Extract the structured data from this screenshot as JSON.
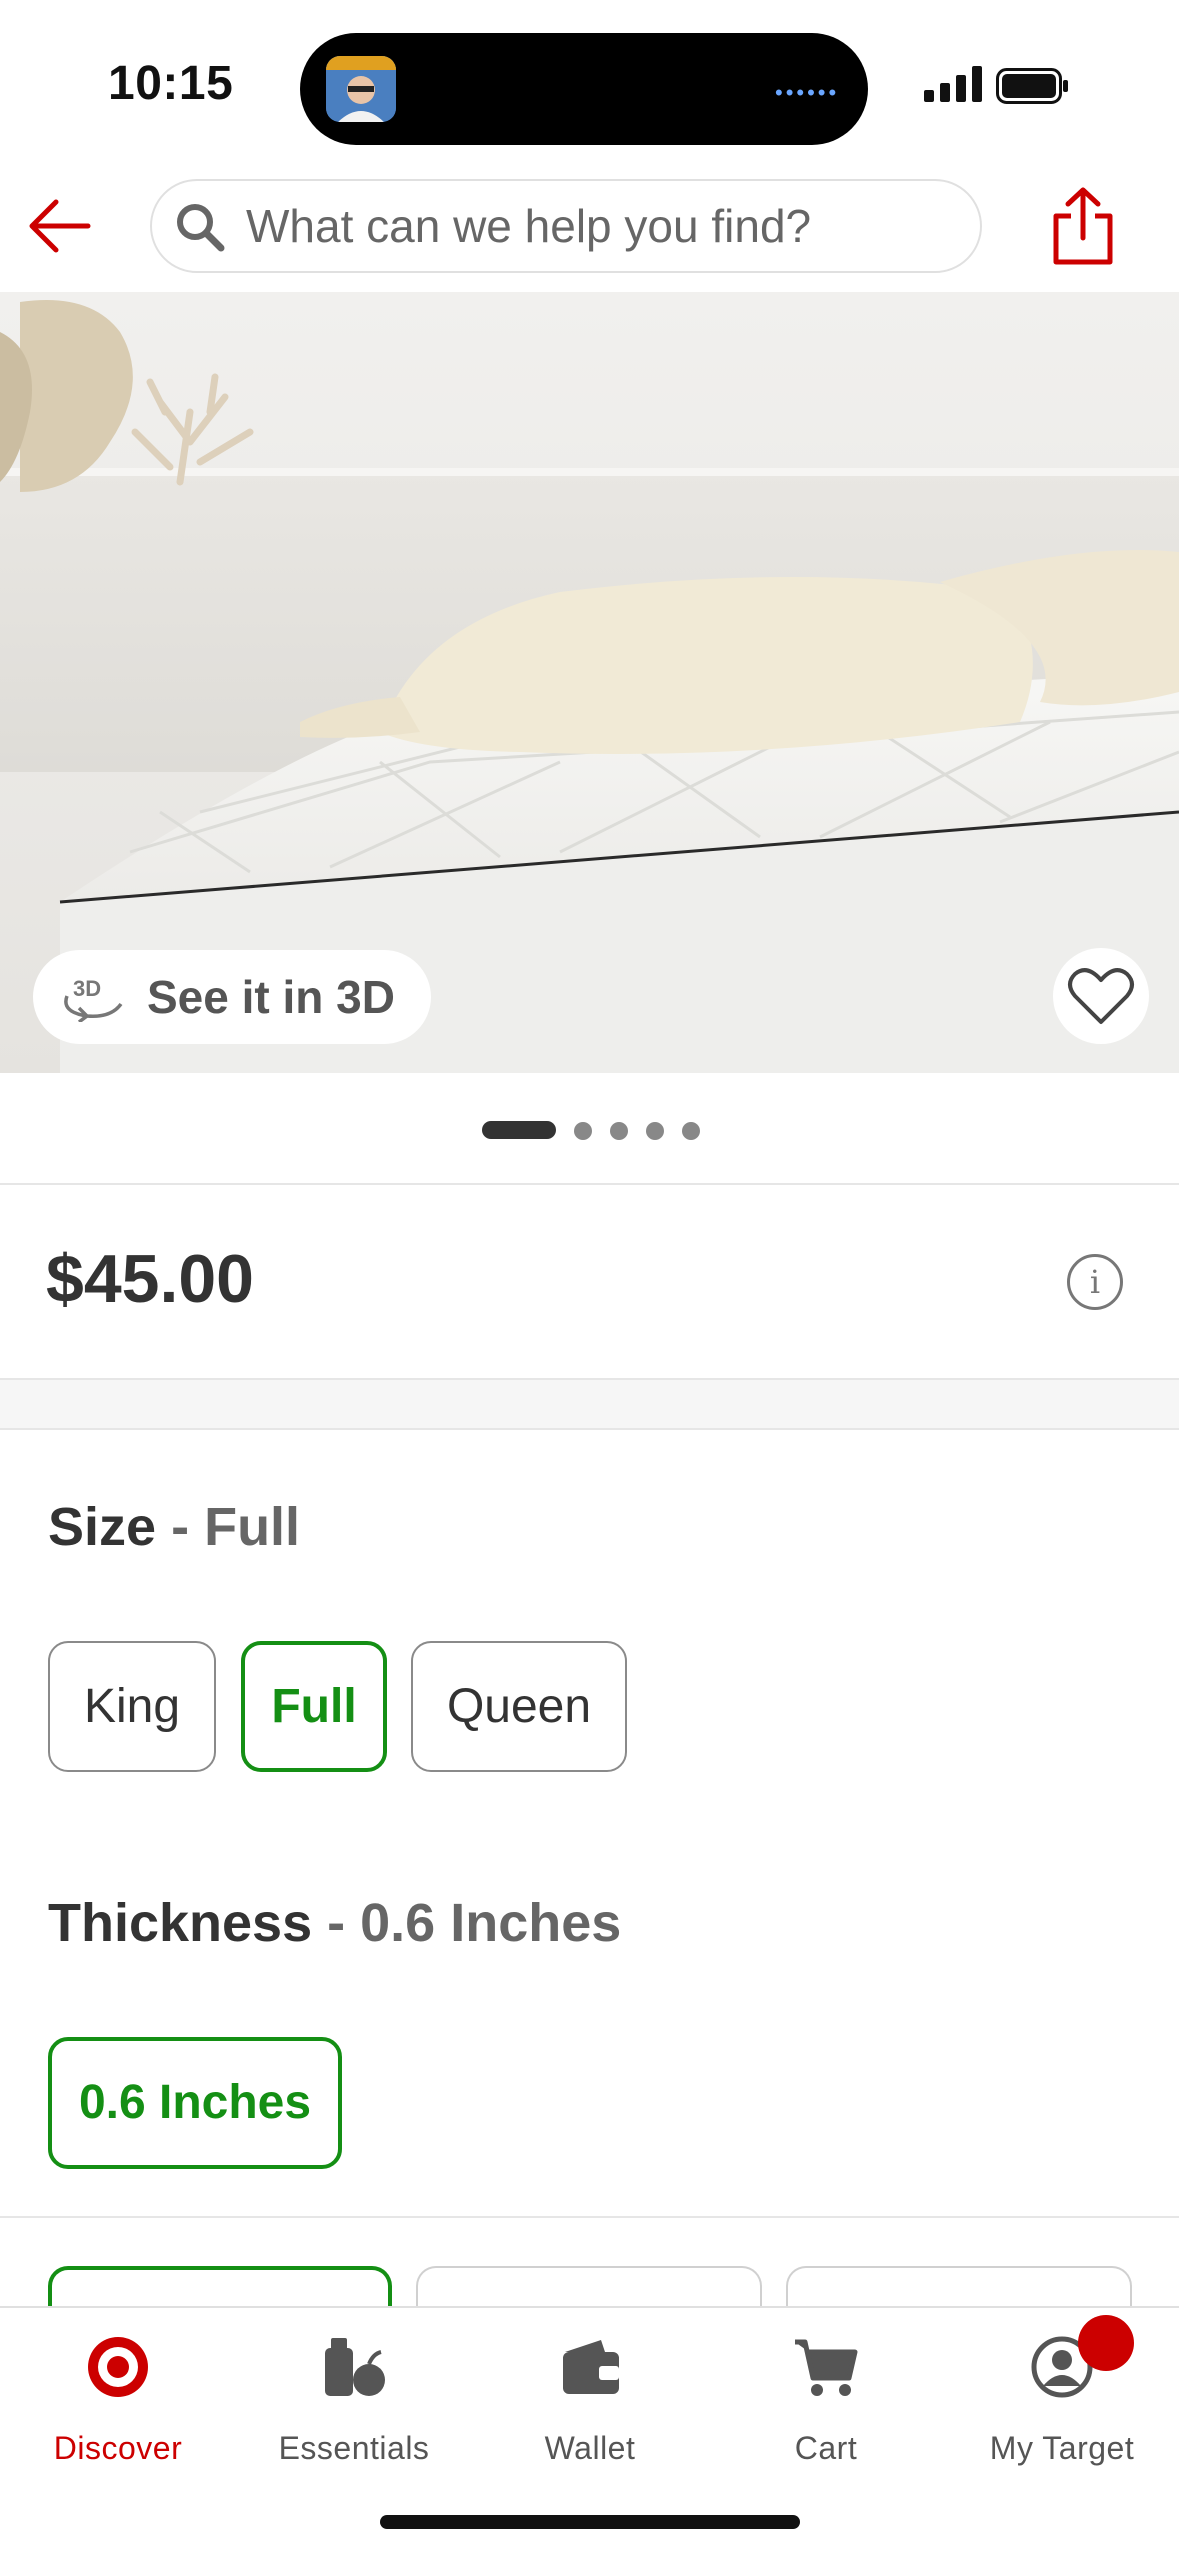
{
  "status_bar": {
    "time": "10:15"
  },
  "header": {
    "search_placeholder": "What can we help you find?"
  },
  "hero": {
    "see_3d_label": "See it in 3D",
    "pager": {
      "count": 5,
      "active_index": 0
    }
  },
  "product": {
    "price": "$45.00"
  },
  "size": {
    "title": "Size",
    "separator": "-",
    "selected": "Full",
    "options": [
      "King",
      "Full",
      "Queen"
    ]
  },
  "thickness": {
    "title": "Thickness",
    "separator": "-",
    "selected": "0.6 Inches",
    "options": [
      "0.6 Inches"
    ]
  },
  "nav": {
    "items": [
      {
        "label": "Discover",
        "icon": "target-bullseye-icon",
        "active": true
      },
      {
        "label": "Essentials",
        "icon": "essentials-icon",
        "active": false
      },
      {
        "label": "Wallet",
        "icon": "wallet-icon",
        "active": false
      },
      {
        "label": "Cart",
        "icon": "cart-icon",
        "active": false
      },
      {
        "label": "My Target",
        "icon": "account-icon",
        "active": false
      }
    ]
  },
  "colors": {
    "brand_red": "#cc0000",
    "selected_green": "#148f14"
  }
}
